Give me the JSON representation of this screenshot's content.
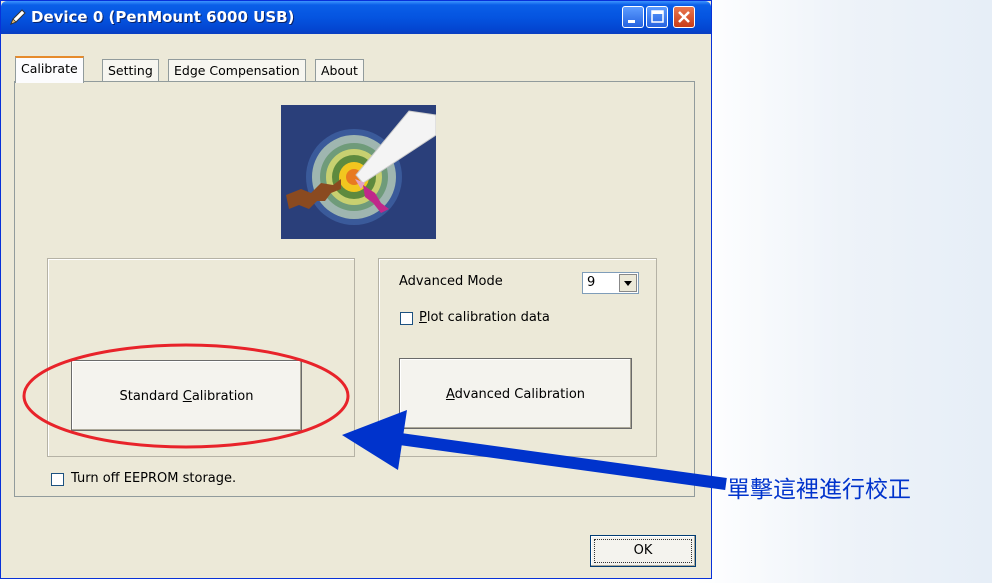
{
  "window": {
    "title": "Device 0 (PenMount 6000 USB)"
  },
  "tabs": [
    {
      "label": "Calibrate",
      "active": true
    },
    {
      "label": "Setting",
      "active": false
    },
    {
      "label": "Edge Compensation",
      "active": false
    },
    {
      "label": "About",
      "active": false
    }
  ],
  "calibrate": {
    "standard_button": {
      "before": "Standard ",
      "mnemonic": "C",
      "after": "alibration"
    },
    "advanced_mode_label": "Advanced Mode",
    "advanced_mode_value": "9",
    "plot_checkbox": {
      "mnemonic": "P",
      "after": "lot calibration data",
      "checked": false
    },
    "advanced_button": {
      "mnemonic": "A",
      "after": "dvanced Calibration"
    },
    "eeprom_checkbox": {
      "label": "Turn off EEPROM storage.",
      "checked": false
    }
  },
  "footer": {
    "ok_label": "OK"
  },
  "annotation": {
    "text": "單擊這裡進行校正",
    "color": "#0033cc",
    "circle_color": "#e8232a"
  },
  "icons": [
    "pen-icon",
    "minimize-icon",
    "maximize-icon",
    "close-icon",
    "target-calibration-icon",
    "chevron-down-icon"
  ]
}
